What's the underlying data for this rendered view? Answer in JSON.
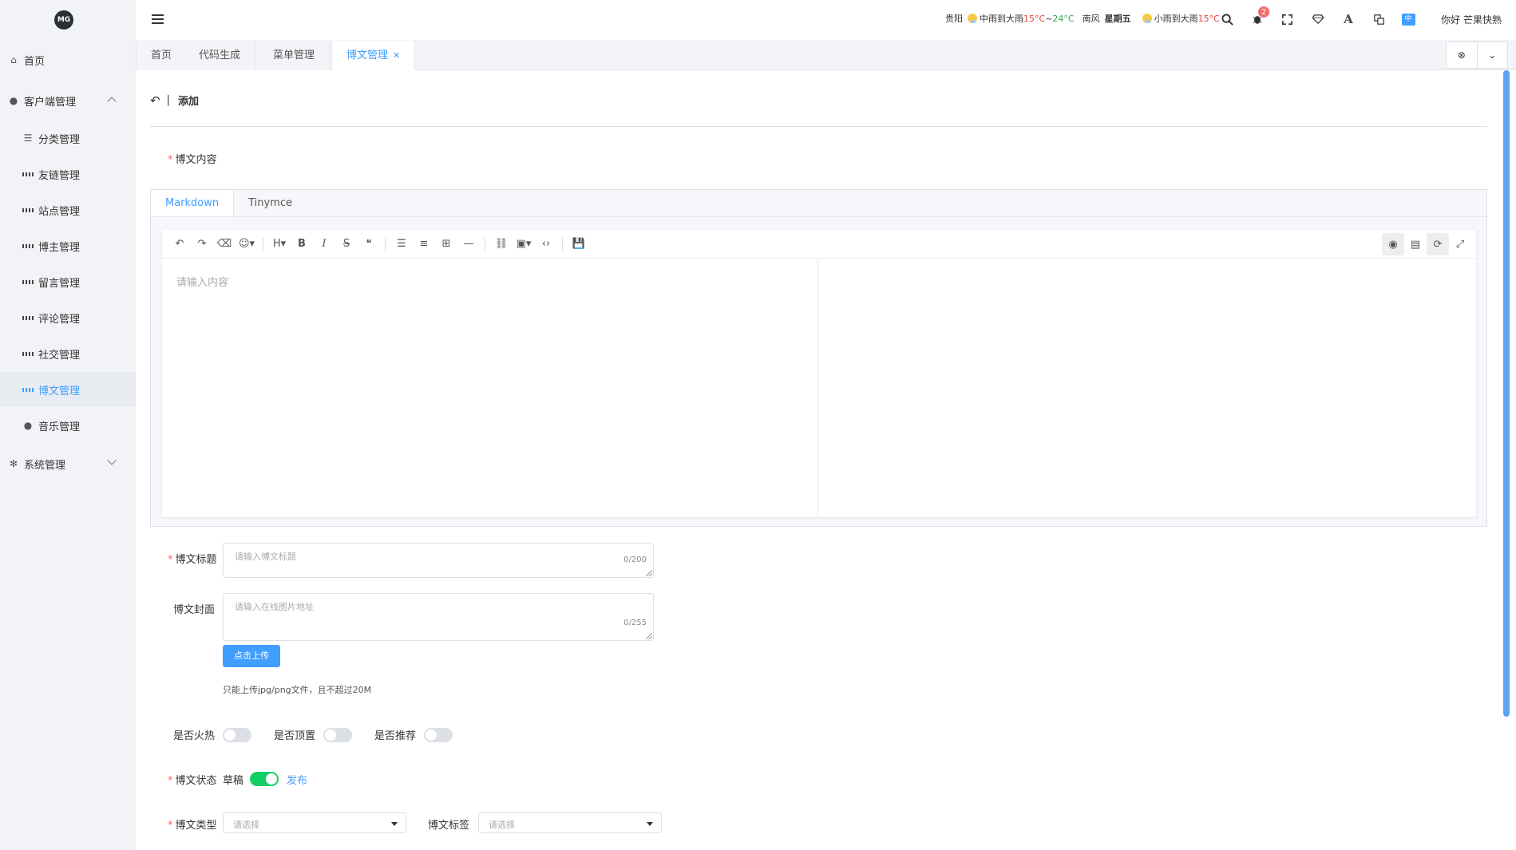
{
  "app": {
    "logo_text": "MG"
  },
  "sidebar": {
    "items": [
      {
        "label": "首页"
      },
      {
        "label": "客户端管理"
      },
      {
        "label": "分类管理"
      },
      {
        "label": "友链管理"
      },
      {
        "label": "站点管理"
      },
      {
        "label": "博主管理"
      },
      {
        "label": "留言管理"
      },
      {
        "label": "评论管理"
      },
      {
        "label": "社交管理"
      },
      {
        "label": "博文管理"
      },
      {
        "label": "音乐管理"
      },
      {
        "label": "系统管理"
      }
    ]
  },
  "header": {
    "weather": {
      "city": "贵阳",
      "today_desc": "中雨到大雨",
      "today_temp_low": "15°C",
      "today_temp_sep": "~",
      "today_temp_high": "24°C",
      "wind": "南风",
      "weekday": "星期五",
      "next_desc": "小雨到大雨",
      "next_temp": "15°C"
    },
    "notification_count": "2",
    "lang_label": "中",
    "greeting": "你好 芒果快熟"
  },
  "tabs": [
    {
      "label": "首页"
    },
    {
      "label": "代码生成"
    },
    {
      "label": "菜单管理"
    },
    {
      "label": "博文管理"
    }
  ],
  "page": {
    "title": "添加",
    "content_label": "博文内容",
    "editor_tabs": [
      "Markdown",
      "Tinymce"
    ],
    "editor_placeholder": "请输入内容",
    "title_label": "博文标题",
    "title_placeholder": "请输入博文标题",
    "title_count": "0/200",
    "cover_label": "博文封面",
    "cover_placeholder": "请输入在线图片地址",
    "cover_count": "0/255",
    "upload_button": "点击上传",
    "upload_hint": "只能上传jpg/png文件，且不超过20M",
    "hot_label": "是否火热",
    "top_label": "是否顶置",
    "recommend_label": "是否推荐",
    "status_label": "博文状态",
    "status_off": "草稿",
    "status_on": "发布",
    "type_label": "博文类型",
    "type_placeholder": "请选择",
    "tag_label": "博文标签",
    "tag_placeholder": "请选择"
  },
  "colors": {
    "accent": "#409eff",
    "switch_on": "#13ce66",
    "required": "#f56c6c"
  }
}
